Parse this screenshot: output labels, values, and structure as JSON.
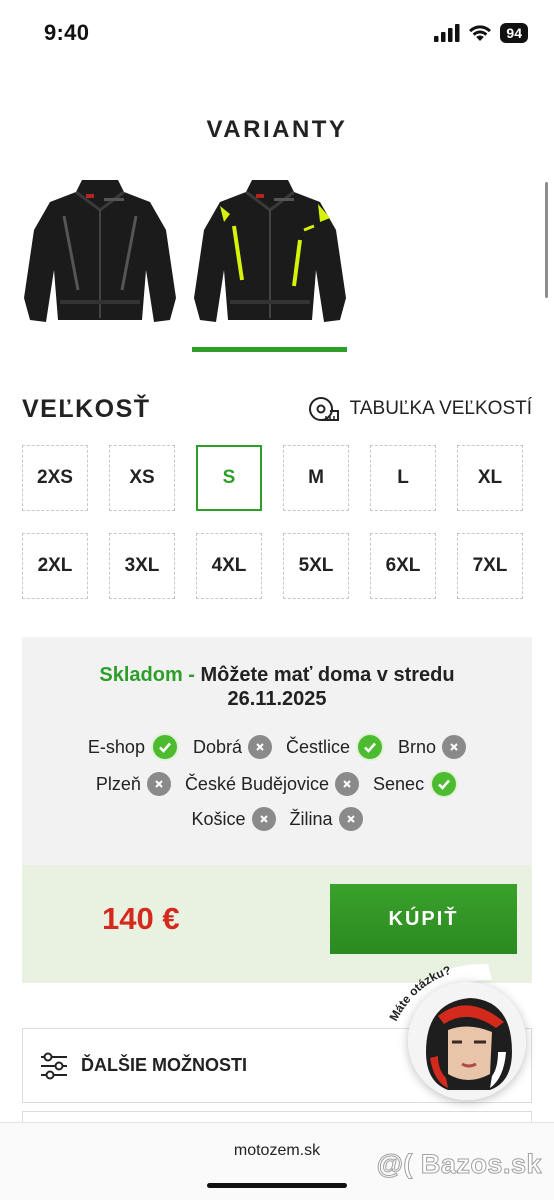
{
  "status_bar": {
    "time": "9:40",
    "battery": "94"
  },
  "variants": {
    "title": "VARIANTY",
    "items": [
      {
        "name": "black-jacket",
        "accent": "#555555"
      },
      {
        "name": "black-fluo-jacket",
        "accent": "#d7f20a"
      }
    ],
    "selected_index": 1
  },
  "size": {
    "title": "VEĽKOSŤ",
    "table_link": "TABUĽKA VEĽKOSTÍ",
    "options": [
      "2XS",
      "XS",
      "S",
      "M",
      "L",
      "XL",
      "2XL",
      "3XL",
      "4XL",
      "5XL",
      "6XL",
      "7XL"
    ],
    "selected": "S"
  },
  "stock": {
    "status": "Skladom -",
    "message_line1": "Môžete mať doma v stredu",
    "message_line2": "26.11.2025",
    "stores": [
      {
        "name": "E-shop",
        "available": true
      },
      {
        "name": "Dobrá",
        "available": false
      },
      {
        "name": "Čestlice",
        "available": true
      },
      {
        "name": "Brno",
        "available": false
      },
      {
        "name": "Plzeň",
        "available": false
      },
      {
        "name": "České Budějovice",
        "available": false
      },
      {
        "name": "Senec",
        "available": true
      },
      {
        "name": "Košice",
        "available": false
      },
      {
        "name": "Žilina",
        "available": false
      }
    ]
  },
  "purchase": {
    "price": "140 €",
    "buy_label": "KÚPIŤ"
  },
  "options": {
    "label": "ĎALŠIE MOŽNOSTI"
  },
  "help": {
    "label": "Máte otázku?"
  },
  "footer": {
    "url": "motozem.sk",
    "watermark": "@( Bazos.sk"
  },
  "colors": {
    "accent_green": "#2e9e2a",
    "price_red": "#d42a1e",
    "fluo_yellow": "#d7f20a"
  }
}
